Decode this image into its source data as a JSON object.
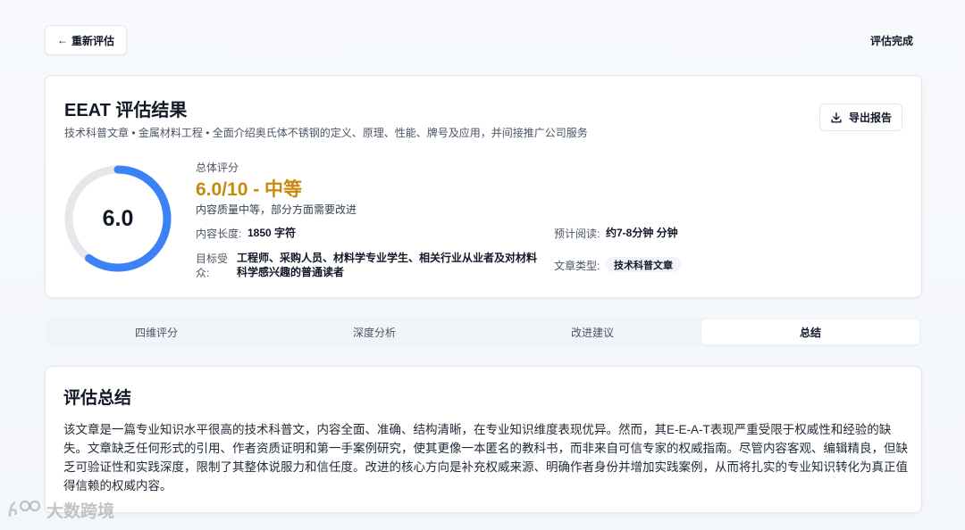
{
  "topbar": {
    "back_label": "重新评估",
    "status": "评估完成"
  },
  "result": {
    "title": "EEAT 评估结果",
    "meta": "技术科普文章 • 金属材料工程 • 全面介绍奥氏体不锈钢的定义、原理、性能、牌号及应用，并间接推广公司服务",
    "export_label": "导出报告",
    "gauge_value": "6.0",
    "score_fraction": 0.6,
    "score_label": "总体评分",
    "score_value": "6.0/10 - 中等",
    "score_desc": "内容质量中等，部分方面需要改进",
    "length_label": "内容长度:",
    "length_value": "1850 字符",
    "reading_label": "预计阅读:",
    "reading_value": "约7-8分钟 分钟",
    "audience_label_1": "目标受",
    "audience_label_2": "众:",
    "audience_value_1": "工程师、采购人员、材料学专业学生、相关行业从业者及对材料",
    "audience_value_2": "科学感兴趣的普通读者",
    "type_label": "文章类型:",
    "type_value": "技术科普文章"
  },
  "tabs": [
    {
      "label": "四维评分"
    },
    {
      "label": "深度分析"
    },
    {
      "label": "改进建议"
    },
    {
      "label": "总结"
    }
  ],
  "summary": {
    "title": "评估总结",
    "text": "该文章是一篇专业知识水平很高的技术科普文，内容全面、准确、结构清晰，在专业知识维度表现优异。然而，其E-E-A-T表现严重受限于权威性和经验的缺失。文章缺乏任何形式的引用、作者资质证明和第一手案例研究，使其更像一本匿名的教科书，而非来自可信专家的权威指南。尽管内容客观、编辑精良，但缺乏可验证性和实践深度，限制了其整体说服力和信任度。改进的核心方向是补充权威来源、明确作者身份并增加实践案例，从而将扎实的专业知识转化为真正值得信赖的权威内容。"
  },
  "watermark": "大数跨境",
  "colors": {
    "accent": "#3b82f6",
    "score": "#c98a0b",
    "track": "#e5e7eb"
  }
}
